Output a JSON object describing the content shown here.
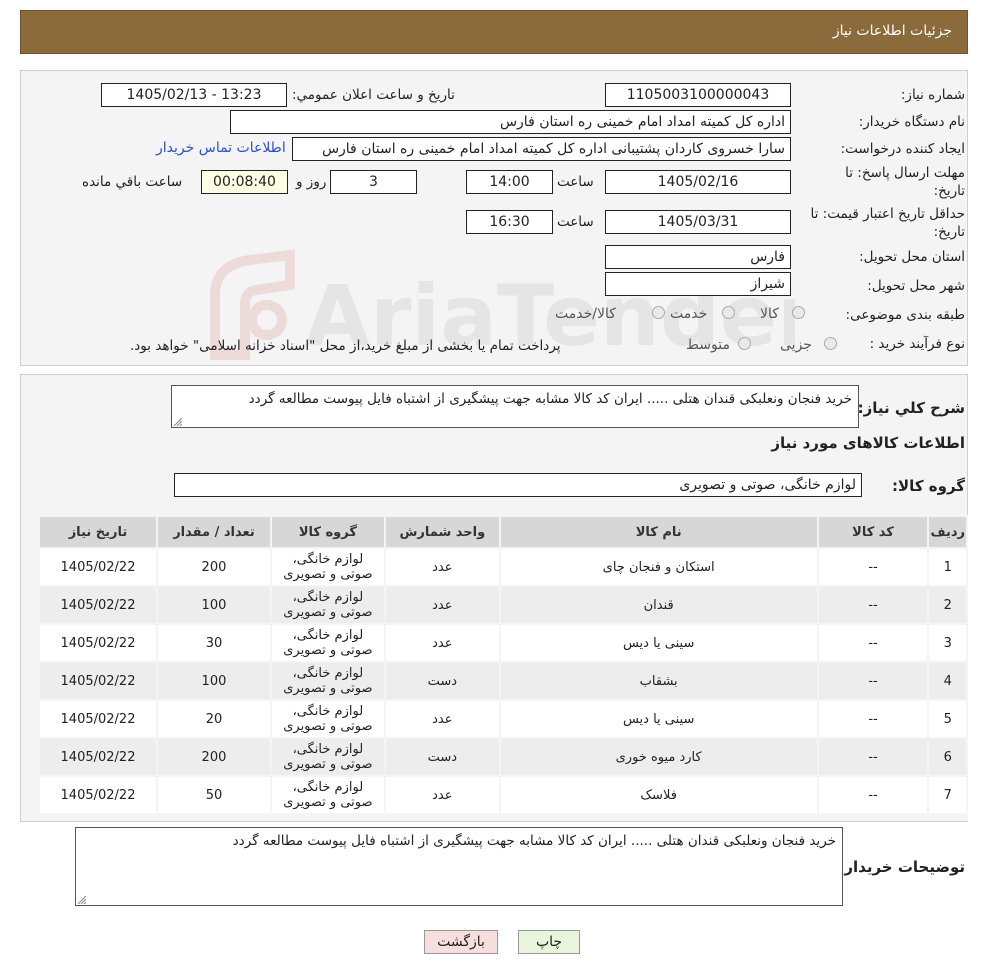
{
  "header": {
    "title": "جزئیات اطلاعات نیاز"
  },
  "form": {
    "need_number_label": "شماره نیاز:",
    "need_number": "1105003100000043",
    "announce_label": "تاریخ و ساعت اعلان عمومي:",
    "announce_value": "1405/02/13 - 13:23",
    "buyer_org_label": "نام دستگاه خریدار:",
    "buyer_org": "اداره کل کمیته امداد امام خمینی  ره  استان فارس",
    "creator_label": "ایجاد کننده درخواست:",
    "creator": "سارا خسروی کاردان پشتیبانی  اداره کل کمیته امداد امام خمینی  ره  استان فارس",
    "contact_link": "اطلاعات تماس خریدار",
    "deadline_label_1": "مهلت ارسال پاسخ: تا",
    "deadline_label_2": "تاریخ:",
    "deadline_date": "1405/02/16",
    "time_label": "ساعت",
    "deadline_time": "14:00",
    "days_value": "3",
    "days_label": "روز و",
    "remaining_time": "00:08:40",
    "remaining_label": "ساعت باقي مانده",
    "validity_label_1": "حداقل تاریخ اعتبار قیمت: تا",
    "validity_label_2": "تاریخ:",
    "validity_date": "1405/03/31",
    "validity_time_label": "ساعت",
    "validity_time": "16:30",
    "province_label": "استان محل تحویل:",
    "province": "فارس",
    "city_label": "شهر محل تحویل:",
    "city": "شیراز",
    "category_label": "طبقه بندی موضوعی:",
    "category_options": [
      "کالا",
      "خدمت",
      "کالا/خدمت"
    ],
    "process_label": "نوع فرآیند خرید :",
    "process_options": [
      "جزیی",
      "متوسط"
    ],
    "process_note": "پرداخت تمام یا بخشی از مبلغ خرید،از محل \"اسناد خزانه اسلامی\" خواهد بود."
  },
  "description": {
    "label": "شرح کلي نیاز:",
    "text": "خرید فنجان ونعلبکی قندان هتلی ..... ایران کد کالا مشابه جهت پیشگیری از اشتباه فایل پیوست مطالعه گردد"
  },
  "items_section": {
    "title": "اطلاعات کالاهای مورد نیاز",
    "group_label": "گروه کالا:",
    "group_value": "لوازم خانگی، صوتی و تصویری",
    "columns": [
      "ردیف",
      "کد کالا",
      "نام کالا",
      "واحد شمارش",
      "گروه کالا",
      "تعداد / مقدار",
      "تاریخ نیاز"
    ],
    "rows": [
      {
        "n": "1",
        "code": "--",
        "name": "استکان و فنجان چای",
        "unit": "عدد",
        "group1": "لوازم خانگی،",
        "group2": "صوتی و تصویری",
        "qty": "200",
        "date": "1405/02/22"
      },
      {
        "n": "2",
        "code": "--",
        "name": "قندان",
        "unit": "عدد",
        "group1": "لوازم خانگی،",
        "group2": "صوتی و تصویری",
        "qty": "100",
        "date": "1405/02/22"
      },
      {
        "n": "3",
        "code": "--",
        "name": "سینی یا دیس",
        "unit": "عدد",
        "group1": "لوازم خانگی،",
        "group2": "صوتی و تصویری",
        "qty": "30",
        "date": "1405/02/22"
      },
      {
        "n": "4",
        "code": "--",
        "name": "بشقاب",
        "unit": "دست",
        "group1": "لوازم خانگی،",
        "group2": "صوتی و تصویری",
        "qty": "100",
        "date": "1405/02/22"
      },
      {
        "n": "5",
        "code": "--",
        "name": "سینی یا دیس",
        "unit": "عدد",
        "group1": "لوازم خانگی،",
        "group2": "صوتی و تصویری",
        "qty": "20",
        "date": "1405/02/22"
      },
      {
        "n": "6",
        "code": "--",
        "name": "کارد میوه خوری",
        "unit": "دست",
        "group1": "لوازم خانگی،",
        "group2": "صوتی و تصویری",
        "qty": "200",
        "date": "1405/02/22"
      },
      {
        "n": "7",
        "code": "--",
        "name": "فلاسک",
        "unit": "عدد",
        "group1": "لوازم خانگی،",
        "group2": "صوتی و تصویری",
        "qty": "50",
        "date": "1405/02/22"
      }
    ]
  },
  "buyer_notes": {
    "label": "توضیحات خریدار:",
    "text": "خرید فنجان ونعلبکی قندان هتلی ..... ایران کد کالا مشابه جهت پیشگیری از اشتباه فایل پیوست مطالعه گردد"
  },
  "buttons": {
    "print": "چاپ",
    "back": "بازگشت"
  },
  "watermark": {
    "text": "AriaTender.neT"
  }
}
